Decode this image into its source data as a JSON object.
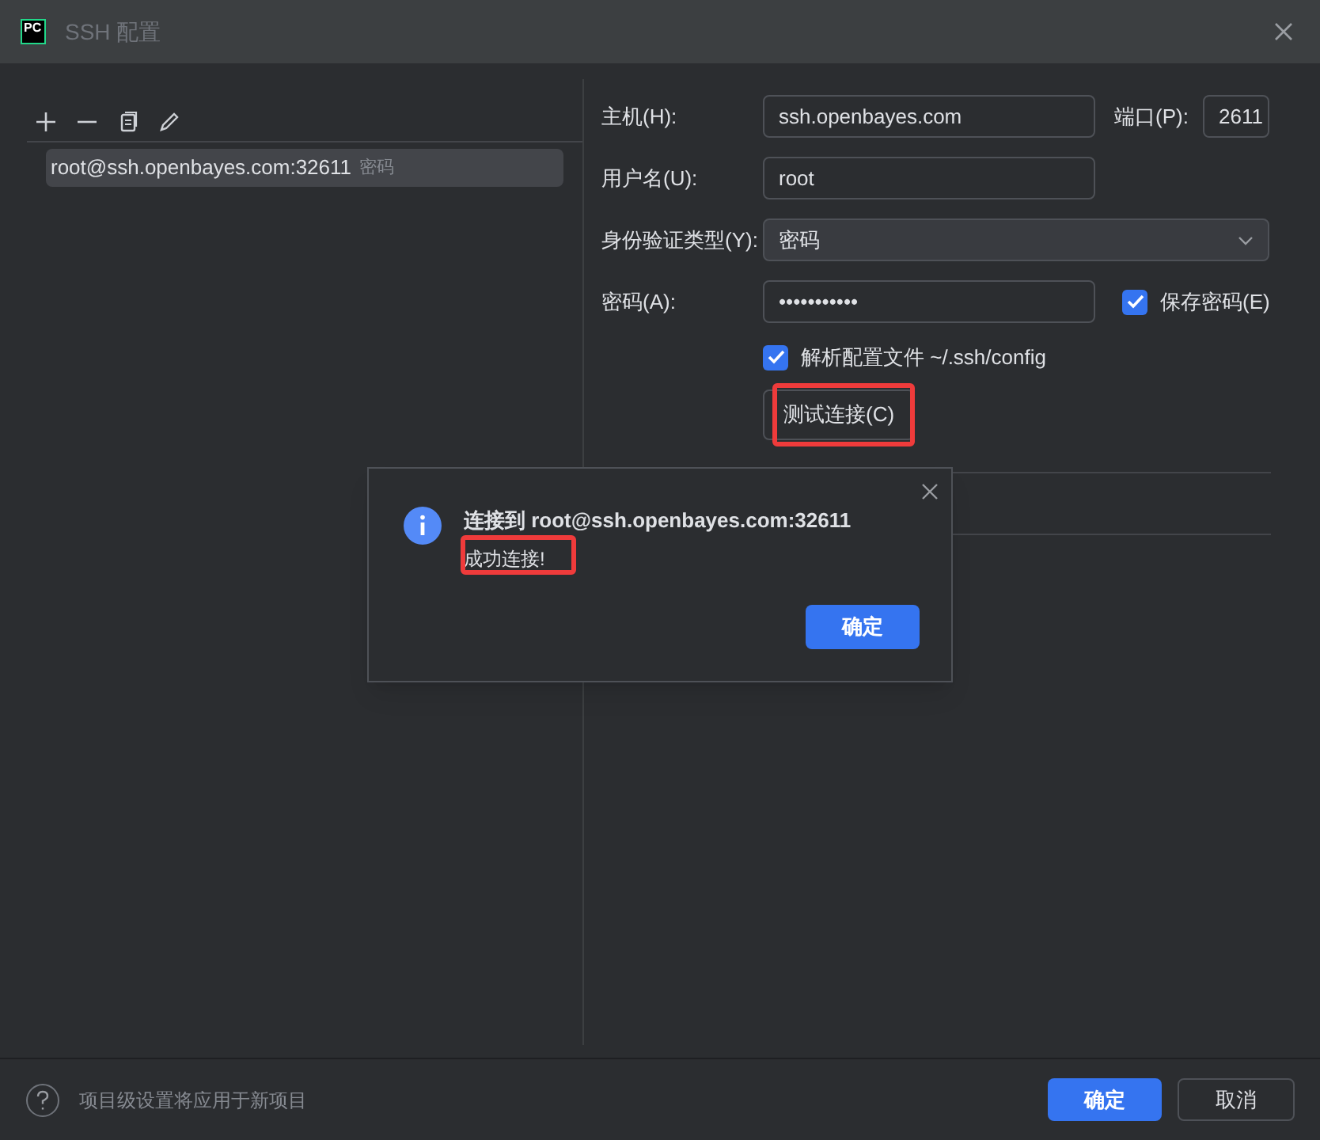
{
  "window": {
    "logo": "PC",
    "title": "SSH 配置"
  },
  "sidebar": {
    "toolbar": [
      {
        "kind": "add"
      },
      {
        "kind": "remove"
      },
      {
        "kind": "copy"
      },
      {
        "kind": "edit"
      }
    ],
    "items": [
      {
        "label": "root@ssh.openbayes.com:32611",
        "note": "密码",
        "selected": true
      }
    ]
  },
  "form": {
    "host": {
      "label": "主机(H):",
      "value": "ssh.openbayes.com"
    },
    "port": {
      "label": "端口(P):",
      "value": "2611"
    },
    "username": {
      "label": "用户名(U):",
      "value": "root"
    },
    "auth_type": {
      "label": "身份验证类型(Y):",
      "value": "密码"
    },
    "password": {
      "label": "密码(A):",
      "value": "•••••••••••"
    },
    "save_password": {
      "label": "保存密码(E)",
      "checked": true
    },
    "parse_config": {
      "label": "解析配置文件 ~/.ssh/config",
      "checked": true
    },
    "test_button": {
      "label": "测试连接(C)",
      "highlighted": true
    }
  },
  "popup": {
    "title": "连接到 root@ssh.openbayes.com:32611",
    "message": "成功连接!",
    "message_highlighted": true,
    "ok": "确定"
  },
  "footer": {
    "hint": "项目级设置将应用于新项目",
    "ok": "确定",
    "cancel": "取消"
  }
}
